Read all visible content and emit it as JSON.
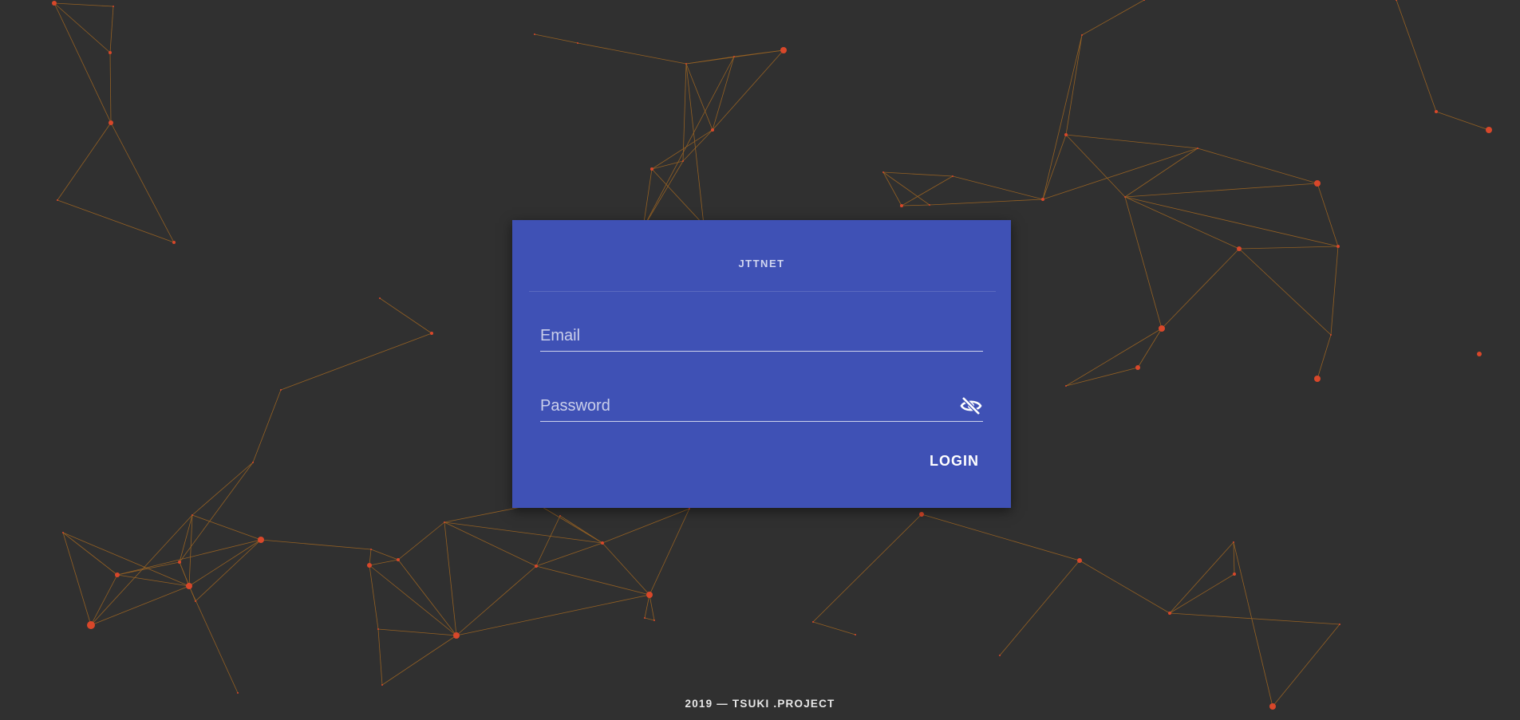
{
  "app": {
    "title": "JTTNET"
  },
  "login_form": {
    "email_placeholder": "Email",
    "email_value": "",
    "password_placeholder": "Password",
    "password_value": "",
    "password_visibility_icon": "eye-off-icon",
    "login_label": "LOGIN"
  },
  "footer": {
    "text": "2019 — TSUKI .PROJECT"
  },
  "colors": {
    "background": "#303030",
    "card": "#3f51b5",
    "network_line": "#b5701f",
    "network_node": "#d8472a"
  }
}
